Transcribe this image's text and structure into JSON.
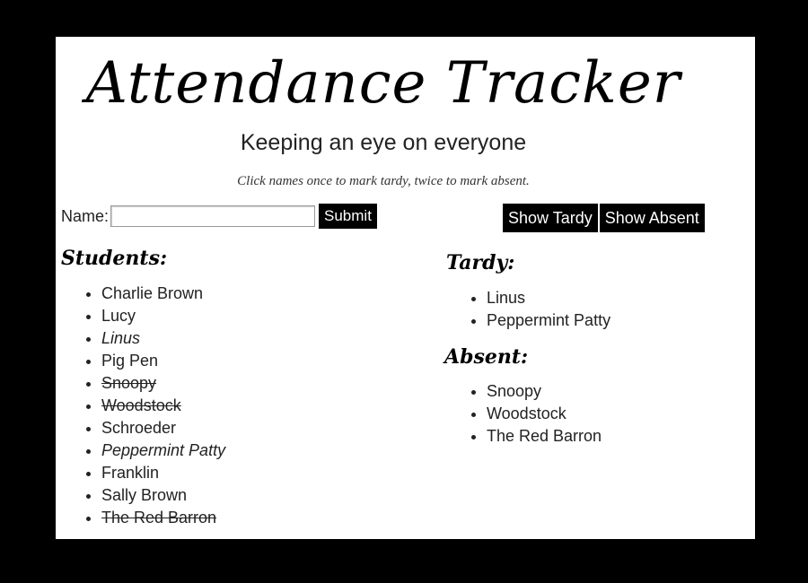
{
  "header": {
    "title": "Attendance Tracker",
    "subtitle": "Keeping an eye on everyone",
    "instructions": "Click names once to mark tardy, twice to mark absent."
  },
  "form": {
    "name_label": "Name:",
    "name_value": "",
    "submit_label": "Submit"
  },
  "buttons": {
    "show_tardy": "Show Tardy",
    "show_absent": "Show Absent"
  },
  "students": {
    "heading": "Students:",
    "items": [
      {
        "name": "Charlie Brown",
        "status": "present"
      },
      {
        "name": "Lucy",
        "status": "present"
      },
      {
        "name": "Linus",
        "status": "tardy"
      },
      {
        "name": "Pig Pen",
        "status": "present"
      },
      {
        "name": "Snoopy",
        "status": "absent"
      },
      {
        "name": "Woodstock",
        "status": "absent"
      },
      {
        "name": "Schroeder",
        "status": "present"
      },
      {
        "name": "Peppermint Patty",
        "status": "tardy"
      },
      {
        "name": "Franklin",
        "status": "present"
      },
      {
        "name": "Sally Brown",
        "status": "present"
      },
      {
        "name": "The Red Barron",
        "status": "absent"
      }
    ]
  },
  "tardy": {
    "heading": "Tardy:",
    "items": [
      "Linus",
      "Peppermint Patty"
    ]
  },
  "absent": {
    "heading": "Absent:",
    "items": [
      "Snoopy",
      "Woodstock",
      "The Red Barron"
    ]
  }
}
